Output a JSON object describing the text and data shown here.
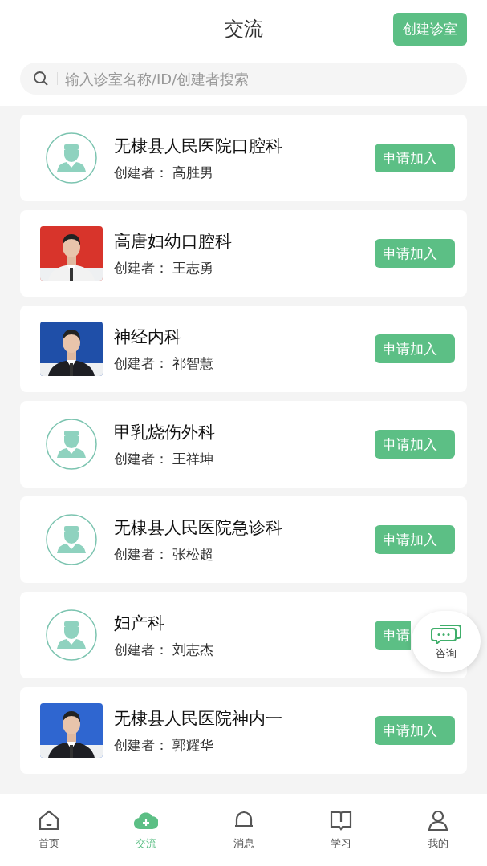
{
  "header": {
    "title": "交流",
    "create_button": "创建诊室"
  },
  "search": {
    "placeholder": "输入诊室名称/ID/创建者搜索"
  },
  "clinics": [
    {
      "name": "无棣县人民医院口腔科",
      "creator_label": "创建者：",
      "creator": "高胜男",
      "avatar": {
        "kind": "icon"
      },
      "button": "申请加入"
    },
    {
      "name": "高唐妇幼口腔科",
      "creator_label": "创建者：",
      "creator": "王志勇",
      "button": "申请加入"
    },
    {
      "name": "神经内科",
      "creator_label": "创建者：",
      "creator": "祁智慧",
      "button": "申请加入"
    },
    {
      "name": "甲乳烧伤外科",
      "creator_label": "创建者：",
      "creator": "王祥坤",
      "avatar": {
        "kind": "icon"
      },
      "button": "申请加入"
    },
    {
      "name": "无棣县人民医院急诊科",
      "creator_label": "创建者：",
      "creator": "张松超",
      "avatar": {
        "kind": "icon"
      },
      "button": "申请加入"
    },
    {
      "name": "妇产科",
      "creator_label": "创建者：",
      "creator": "刘志杰",
      "avatar": {
        "kind": "icon"
      },
      "button": "申请",
      "covered": true
    },
    {
      "name": "无棣县人民医院神内一",
      "creator_label": "创建者：",
      "creator": "郭耀华",
      "button": "申请加入"
    }
  ],
  "consult_button": {
    "label": "咨询"
  },
  "nav": [
    {
      "label": "首页",
      "kind": "home",
      "selected": false
    },
    {
      "label": "交流",
      "kind": "cloud",
      "selected": true
    },
    {
      "label": "消息",
      "kind": "bell",
      "selected": false
    },
    {
      "label": "学习",
      "kind": "book",
      "selected": false
    },
    {
      "label": "我的",
      "kind": "user",
      "selected": false
    }
  ]
}
